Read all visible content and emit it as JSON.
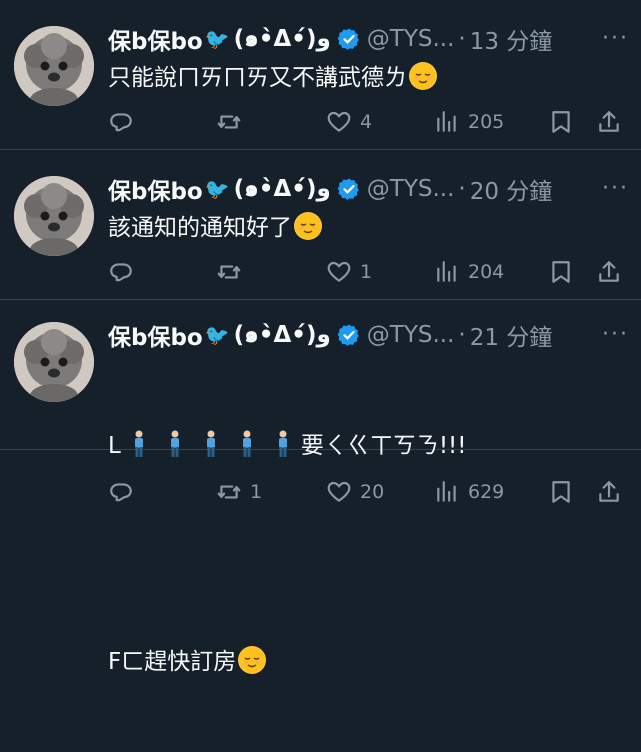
{
  "tweets": [
    {
      "name": "保b保bo",
      "kaomoji": "(๑•̀Δ•́)و",
      "handle": "@TYS...",
      "dot": "·",
      "time": "13 分鐘",
      "more": "···",
      "text": "只能說ㄇㄞㄇㄞ又不講武德ㄌ",
      "text_lines": [],
      "replies": "",
      "retweets": "",
      "likes": "4",
      "views": "205"
    },
    {
      "name": "保b保bo",
      "kaomoji": "(๑•̀Δ•́)و",
      "handle": "@TYS...",
      "dot": "·",
      "time": "20 分鐘",
      "more": "···",
      "text": "該通知的通知好了",
      "replies": "",
      "retweets": "",
      "likes": "1",
      "views": "204"
    },
    {
      "name": "保b保bo",
      "kaomoji": "(๑•̀Δ•́)و",
      "handle": "@TYS...",
      "dot": "·",
      "time": "21 分鐘",
      "more": "···",
      "line1_prefix": "L",
      "line1_suffix": "要ㄑㄍㄒㄎㄋ!!!",
      "line2": "Fㄈ趕快訂房",
      "replies": "",
      "retweets": "1",
      "likes": "20",
      "views": "629"
    }
  ],
  "colors": {
    "bg": "#15202b",
    "text": "#f7f9f9",
    "muted": "#8b98a5",
    "accent": "#1d9bf0",
    "divider": "#38444d"
  },
  "icons": [
    "reply-icon",
    "retweet-icon",
    "heart-icon",
    "views-icon",
    "bookmark-icon",
    "share-icon",
    "verified-badge-icon",
    "twitter-bird-icon",
    "relieved-face-emoji",
    "person-standing-emoji"
  ]
}
